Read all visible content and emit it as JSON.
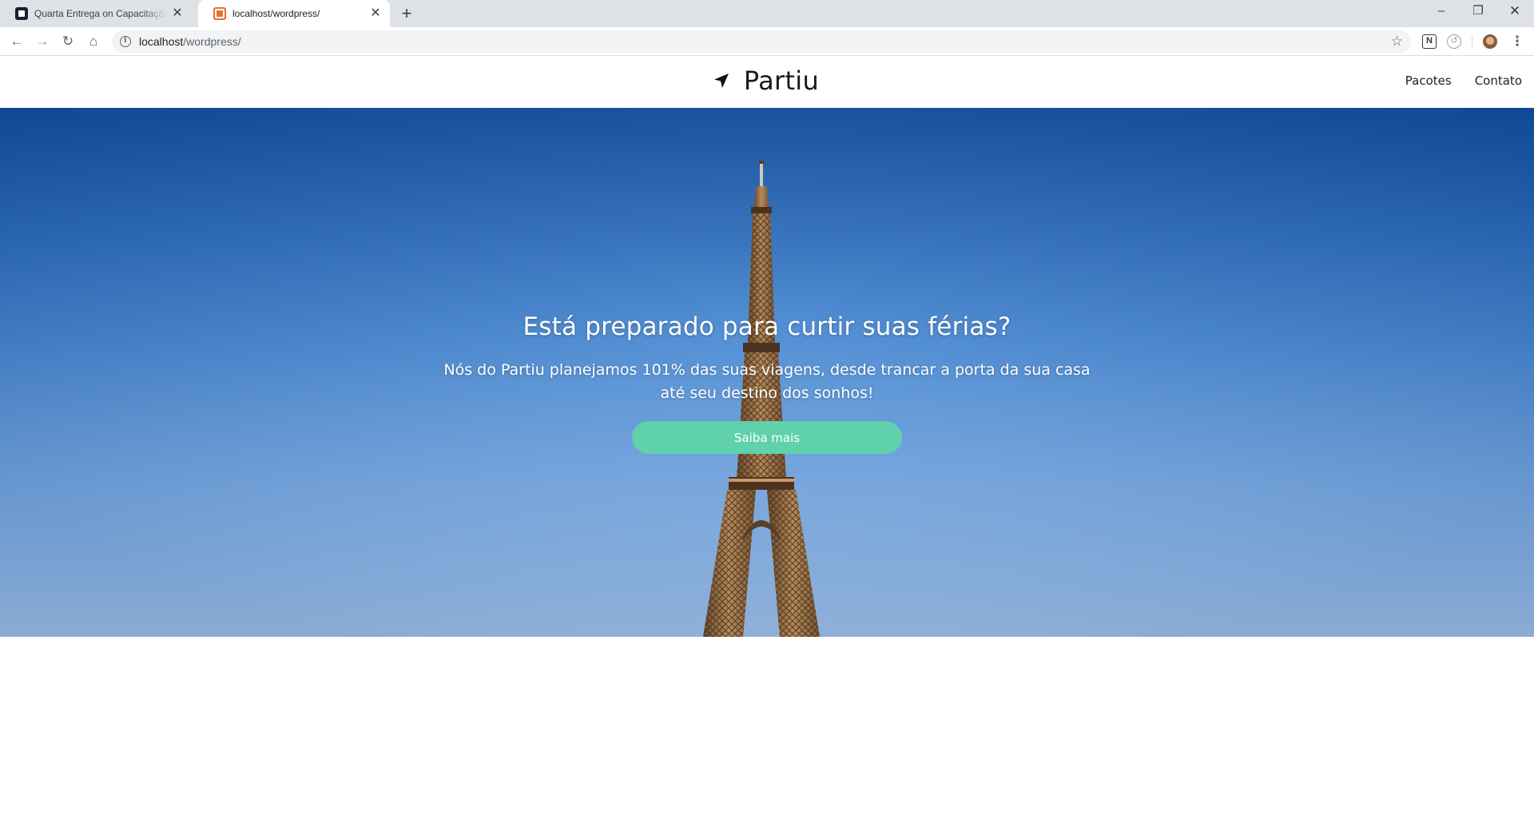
{
  "browser": {
    "tabs": [
      {
        "title": "Quarta Entrega on Capacitação e",
        "favicon": "trello-icon"
      },
      {
        "title": "localhost/wordpress/",
        "favicon": "xampp-icon"
      }
    ],
    "new_tab_icon": "+",
    "window_controls": {
      "minimize": "–",
      "maximize": "❐",
      "close": "✕"
    },
    "toolbar": {
      "back": "←",
      "forward": "→",
      "reload": "↻",
      "home": "⌂",
      "menu": "⋮",
      "star": "☆"
    },
    "url_host": "localhost",
    "url_path": "/wordpress/",
    "extensions": {
      "notion": "N",
      "clock": "↺"
    }
  },
  "site": {
    "brand": "Partiu",
    "brand_icon": "navigation-arrow-icon",
    "nav": [
      "Pacotes",
      "Contato"
    ],
    "hero": {
      "title": "Está preparado para curtir suas férias?",
      "text": "Nós do Partiu planejamos 101% das suas viagens, desde trancar a porta da sua casa até seu destino dos sonhos!",
      "button": "Saiba mais"
    }
  },
  "colors": {
    "accent_button": "#5fd1ad",
    "sky_top": "#12519e",
    "sky_bottom": "#a7c9ee"
  }
}
